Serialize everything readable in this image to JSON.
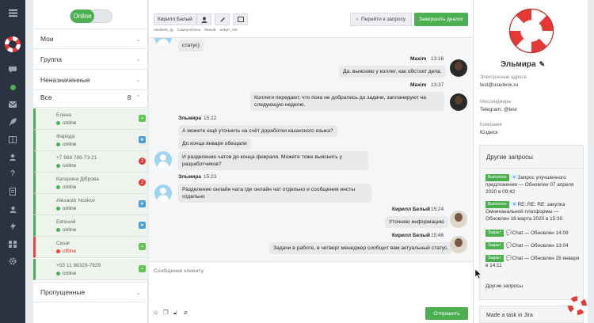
{
  "rail": {
    "icons": [
      "menu-icon",
      "lifebuoy-logo",
      "chats-icon",
      "status-icon",
      "inbox-icon",
      "rocket-icon",
      "book-icon",
      "users-icon",
      "help-icon",
      "document-icon",
      "user-icon",
      "lightning-icon",
      "integrations-icon",
      "settings-icon"
    ]
  },
  "status_toggle": {
    "label": "Online"
  },
  "groups": {
    "mine": "Мои",
    "group": "Группа",
    "unassigned": "Неназначенные",
    "all": "Все",
    "all_count": "8",
    "missed": "Пропущенные"
  },
  "conversations": [
    {
      "name": "Елена",
      "status": "online",
      "badge": "chat",
      "badge_text": ""
    },
    {
      "name": "Фарида",
      "status": "online",
      "badge": "telegram",
      "badge_text": ""
    },
    {
      "name": "+7 988 786-73-21",
      "status": "online",
      "badge": "count",
      "badge_text": "2"
    },
    {
      "name": "Катерина Діброва",
      "status": "online",
      "badge": "count",
      "badge_text": "2"
    },
    {
      "name": "Alexandr Noskov",
      "status": "online",
      "badge": "telegram",
      "badge_text": ""
    },
    {
      "name": "Евгений",
      "status": "online",
      "badge": "telegram",
      "badge_text": ""
    },
    {
      "name": "Cesar",
      "status": "offline",
      "badge": "chat",
      "badge_text": ""
    },
    {
      "name": "+55 11 96329-7829",
      "status": "online",
      "badge": "chat",
      "badge_text": ""
    }
  ],
  "chat": {
    "toolbar": {
      "agent": "Кирилл Белый",
      "tool_labels": [
        "usedesk_tg",
        "Самоучитель",
        "белый",
        "алерт_чат"
      ],
      "goto_label": "Перейти к запросу",
      "finish_label": "Завершить диалог"
    },
    "top_fragment": "статус)",
    "messages": {
      "m1_author": "Maxim",
      "m1_time": "13:16",
      "m1_text": "Да, выясняю у коллег, как обстоят дела.",
      "m2_author": "Maxim",
      "m2_time": "13:37",
      "m2_text": "Коллеги передают, что пока не добрались до задачи, запланируют на следующую неделю.",
      "m3_author": "Эльмира",
      "m3_time": "15:22",
      "m3_a": "А можете ещё уточнить на счёт доработки казахского языка?",
      "m3_b": "До конца января обещали",
      "m3_c": "И разделение чатов до конца февраля. Можете тоже выяснить у разработчиков?",
      "m4_author": "Эльмира",
      "m4_time": "15:23",
      "m4_text": "Разделение онлайн чата где онлайн чат отдельно и сообщения инсты отдельно",
      "m5_author": "Кирилл Белый",
      "m5_time": "15:24",
      "m5_text": "Уточняю информацию",
      "m6_author": "Кирилл Белый",
      "m6_time": "15:46",
      "m6_text": "Задачи в работе, в четверг менеджер сообщит вам актуальный статус."
    },
    "composer": {
      "placeholder": "Сообщение клиенту",
      "send_label": "Отправить"
    }
  },
  "profile": {
    "name": "Эльмира",
    "email_label": "Электронные адреса",
    "email": "test@usedesk.ru",
    "messengers_label": "Мессенджеры",
    "telegram": "Telegram: @test",
    "company_label": "Компания",
    "company": "Юздеск",
    "other_requests_title": "Другие запросы",
    "requests": [
      {
        "tag": "Выполнен",
        "text": "📧Запрос улучшенного предложения — Обновлен 07 апреля 2020 в 09:42"
      },
      {
        "tag": "Выполнен",
        "text": "📧RE: RE: RE: закупка Омниканальной платформы — Обновлен 18 марта 2020 в 15:30"
      },
      {
        "tag": "Закрыт",
        "text": "💬Chat — Обновлен 14:09"
      },
      {
        "tag": "Закрыт",
        "text": "💬Chat — Обновлен 13:04"
      },
      {
        "tag": "Закрыт",
        "text": "💬Chat — Обновлен 28 января в 14:11"
      }
    ],
    "more_requests": "Другие запросы",
    "jira": "Made a task in Jira"
  },
  "colors": {
    "accent": "#4caf50",
    "rail": "#2b3340",
    "offline": "#e53935",
    "telegram": "#4a9fd8"
  }
}
